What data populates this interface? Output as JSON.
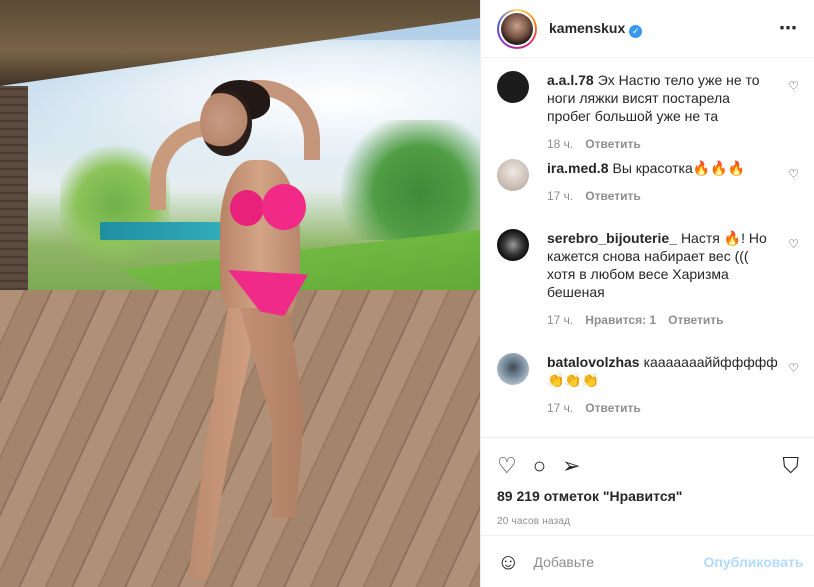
{
  "header": {
    "username": "kamenskux",
    "verified_badge": "✓",
    "more_icon": "⋯"
  },
  "comments": [
    {
      "user": "a.a.l.78",
      "text": "Эх Настю тело уже не то ноги ляжки висят постарела пробег большой уже не та",
      "time": "18 ч.",
      "likes": "",
      "reply": "Ответить",
      "avatar_color": "#1c1c1c"
    },
    {
      "user": "ira.med.8",
      "text": "Вы красотка🔥🔥🔥",
      "time": "17 ч.",
      "likes": "",
      "reply": "Ответить",
      "avatar_color": "#d8cfc7"
    },
    {
      "user": "serebro_bijouterie_",
      "text": "Настя 🔥! Но кажется снова набирает вес ((( хотя в любом весе Харизма бешеная",
      "time": "17 ч.",
      "likes": "Нравится: 1",
      "reply": "Ответить",
      "avatar_color": "#111111"
    },
    {
      "user": "batalovolzhas",
      "text": "каааааааййффффф👏👏👏",
      "time": "17 ч.",
      "likes": "",
      "reply": "Ответить",
      "avatar_color": "#7f93a3"
    }
  ],
  "actions": {
    "like_icon": "♡",
    "comment_icon": "○",
    "share_icon": "➢",
    "bookmark_icon": "⛉",
    "likes_text": "89 219 отметок \"Нравится\"",
    "time_ago": "20 часов назад"
  },
  "add_comment": {
    "emoji_icon": "☺",
    "placeholder": "Добавьте",
    "publish_label": "Опубликовать"
  },
  "colors": {
    "accent": "#3897f0",
    "publish_disabled": "#b3dbff",
    "muted": "#8e8e8e",
    "bikini": "#ef2a88"
  }
}
